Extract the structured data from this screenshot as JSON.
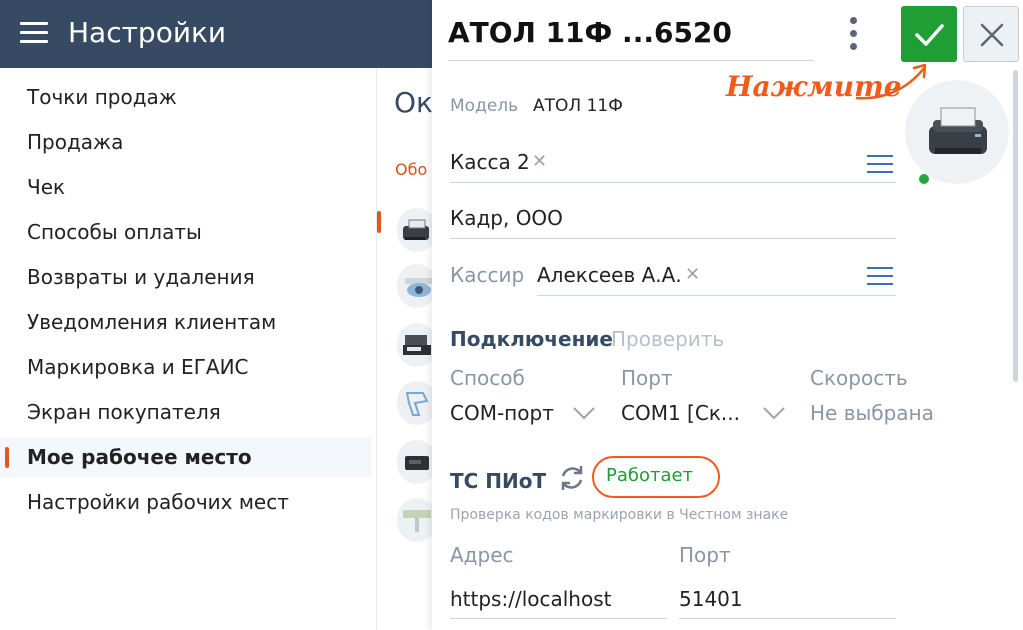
{
  "header": {
    "title": "Настройки"
  },
  "sidebar": {
    "items": [
      {
        "label": "Точки продаж"
      },
      {
        "label": "Продажа"
      },
      {
        "label": "Чек"
      },
      {
        "label": "Способы оплаты"
      },
      {
        "label": "Возвраты и удаления"
      },
      {
        "label": "Уведомления клиентам"
      },
      {
        "label": "Маркировка и ЕГАИС"
      },
      {
        "label": "Экран покупателя"
      },
      {
        "label": "Мое рабочее место",
        "active": true
      },
      {
        "label": "Настройки рабочих мест"
      }
    ]
  },
  "background": {
    "title_fragment": "Окн",
    "link_fragment": "Обо"
  },
  "panel": {
    "title": "АТОЛ 11Ф ...6520",
    "callout": "Нажмите",
    "model_label": "Модель",
    "model_value": "АТОЛ 11Ф",
    "kassa_value": "Касса 2",
    "org_value": "Кадр, ООО",
    "cashier_label": "Кассир",
    "cashier_value": "Алексеев А.А.",
    "connection": {
      "title": "Подключение",
      "check_link": "Проверить",
      "method_label": "Способ",
      "method_value": "COM-порт",
      "port_label": "Порт",
      "port_value": "COM1 [Ск...",
      "speed_label": "Скорость",
      "speed_value": "Не выбрана"
    },
    "ts_piot": {
      "title": "ТС ПИоТ",
      "status": "Работает",
      "hint": "Проверка кодов маркировки в Честном знаке",
      "address_label": "Адрес",
      "address_value": "https://localhost",
      "port_label": "Порт",
      "port_value": "51401"
    },
    "status_color": "#24a83d",
    "accent": "#e1581b"
  }
}
